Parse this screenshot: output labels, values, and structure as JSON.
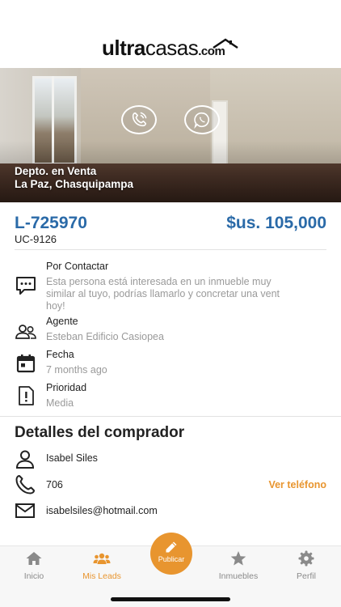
{
  "brand": {
    "logo_bold": "ultra",
    "logo_light": "casas",
    "logo_suffix": ".com"
  },
  "hero": {
    "line1": "Depto. en Venta",
    "line2": "La Paz, Chasquipampa"
  },
  "listing": {
    "code": "L-725970",
    "price": "$us. 105,000",
    "subcode": "UC-9126"
  },
  "details": {
    "status": {
      "title": "Por Contactar",
      "text": "Esta persona está interesada en un inmueble muy\nsimilar al tuyo, podrías llamarlo y concretar una vent\nhoy!"
    },
    "agent": {
      "title": "Agente",
      "text": "Esteban Edificio Casiopea"
    },
    "date": {
      "title": "Fecha",
      "text": "7 months ago"
    },
    "priority": {
      "title": "Prioridad",
      "text": "Media"
    }
  },
  "buyer": {
    "section_title": "Detalles del comprador",
    "name": "Isabel Siles",
    "phone": "706",
    "view_phone_label": "Ver teléfono",
    "email": "isabelsiles@hotmail.com"
  },
  "tabs": {
    "home": "Inicio",
    "leads": "Mis Leads",
    "publish": "Publicar",
    "properties": "Inmuebles",
    "profile": "Perfil"
  },
  "colors": {
    "accent": "#e8952f",
    "brand_blue": "#2a6aa8",
    "tab_gray": "#8a8a8a"
  }
}
